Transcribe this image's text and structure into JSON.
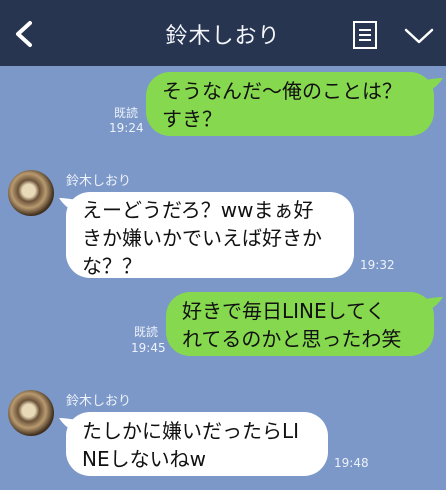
{
  "header": {
    "title": "鈴木しおり"
  },
  "messages": [
    {
      "side": "me",
      "lines": [
        "そうなんだ〜俺のことは？",
        "すき？"
      ],
      "read": "既読",
      "time": "19:24"
    },
    {
      "side": "other",
      "sender": "鈴木しおり",
      "lines": [
        "えーどうだろ？wwまぁ好",
        "きか嫌いかでいえば好きか",
        "な？？"
      ],
      "time": "19:32"
    },
    {
      "side": "me",
      "lines": [
        "好きで毎日LINEしてく",
        "れてるのかと思ったわ笑"
      ],
      "read": "既読",
      "time": "19:45"
    },
    {
      "side": "other",
      "sender": "鈴木しおり",
      "lines": [
        "たしかに嫌いだったらLI",
        "NEしないねw"
      ],
      "time": "19:48"
    }
  ]
}
